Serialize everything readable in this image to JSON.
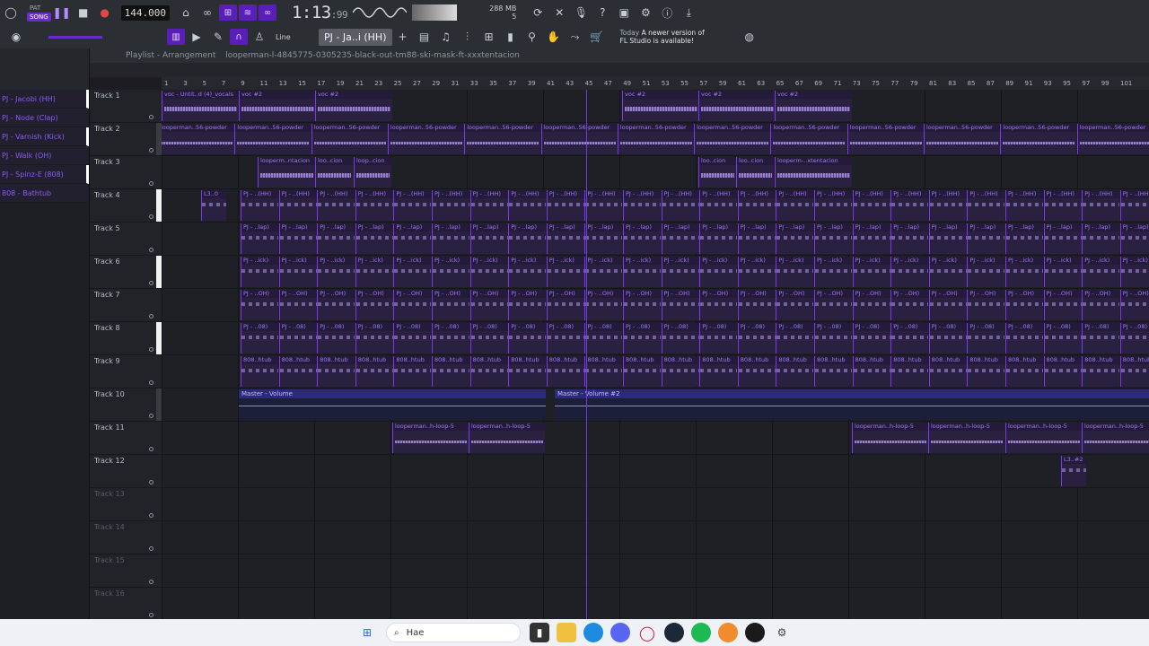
{
  "transport": {
    "mode_labels": [
      "PAT",
      "SONG"
    ],
    "tempo": "144.000",
    "time_main": "1:13",
    "time_sub": "99",
    "memory": "288 MB",
    "memory_sub": "5"
  },
  "toolbar2": {
    "snap": "Line",
    "pattern": "PJ - Ja..i (HH)",
    "news_line1_prefix": "Today",
    "news_line1": "A newer version of",
    "news_line2": "FL Studio is available!"
  },
  "playlist": {
    "title": "Playlist - Arrangement",
    "file": "looperman-l-4845775-0305235-black-out-tm88-ski-mask-ft-xxxtentacion"
  },
  "sidebar": {
    "items": [
      {
        "label": "PJ - Jacobi (HH)",
        "selected": true
      },
      {
        "label": "PJ - Node (Clap)",
        "selected": false
      },
      {
        "label": "PJ - Varnish (Kick)",
        "selected": true
      },
      {
        "label": "PJ - Walk (OH)",
        "selected": false
      },
      {
        "label": "PJ - Spinz-E (808)",
        "selected": true
      },
      {
        "label": "808 - Bathtub",
        "selected": false
      }
    ]
  },
  "ruler": [
    "1",
    "3",
    "5",
    "7",
    "9",
    "11",
    "13",
    "15",
    "17",
    "19",
    "21",
    "23",
    "25",
    "27",
    "29",
    "31",
    "33",
    "35",
    "37",
    "39",
    "41",
    "43",
    "45",
    "47",
    "49",
    "51",
    "53",
    "55",
    "57",
    "59",
    "61",
    "63",
    "65",
    "67",
    "69",
    "71",
    "73",
    "75",
    "77",
    "79",
    "81",
    "83",
    "85",
    "87",
    "89",
    "91",
    "93",
    "95",
    "97",
    "99",
    "101"
  ],
  "tracks": [
    {
      "name": "Track 1",
      "bar": "none",
      "active": true
    },
    {
      "name": "Track 2",
      "bar": "dark",
      "active": true
    },
    {
      "name": "Track 3",
      "bar": "none",
      "active": true
    },
    {
      "name": "Track 4",
      "bar": "white",
      "active": true
    },
    {
      "name": "Track 5",
      "bar": "none",
      "active": true
    },
    {
      "name": "Track 6",
      "bar": "white",
      "active": true
    },
    {
      "name": "Track 7",
      "bar": "none",
      "active": true
    },
    {
      "name": "Track 8",
      "bar": "white",
      "active": true
    },
    {
      "name": "Track 9",
      "bar": "none",
      "active": true
    },
    {
      "name": "Track 10",
      "bar": "dark",
      "active": true
    },
    {
      "name": "Track 11",
      "bar": "none",
      "active": true
    },
    {
      "name": "Track 12",
      "bar": "none",
      "active": true
    },
    {
      "name": "Track 13",
      "bar": "none",
      "active": false
    },
    {
      "name": "Track 14",
      "bar": "none",
      "active": false
    },
    {
      "name": "Track 15",
      "bar": "none",
      "active": false
    },
    {
      "name": "Track 16",
      "bar": "none",
      "active": false
    }
  ],
  "clip_labels": {
    "t1": [
      "voc - Untit..d (4)_vocals",
      "voc #2",
      "voc #2",
      "voc #2",
      "voc #2",
      "voc #2"
    ],
    "t2": "looperman..56-powder",
    "t3": [
      "looperm..ntacion",
      "loo..cion",
      "loop..cion",
      "loo..cion",
      "loo..cion",
      "looperm-..xtentacion"
    ],
    "t4": "PJ - ..(HH)",
    "t5": "PJ - ..lap)",
    "t6": "PJ - ..ick)",
    "t7": "PJ - ..OH)",
    "t8": "PJ - ..08)",
    "t9": "808..htub",
    "t10": [
      "Master - Volume",
      "Master - Volume #2"
    ],
    "t11": "looperman..h-loop-5",
    "t12": "L3..#2",
    "t4_first": "L3..0"
  },
  "taskbar": {
    "search_placeholder": "Hae",
    "icons": [
      "windows-start-icon",
      "file-explorer-icon",
      "edge-icon",
      "discord-icon",
      "opera-icon",
      "steam-icon",
      "spotify-icon",
      "fl-studio-icon",
      "chat-icon",
      "settings-icon"
    ]
  },
  "colors": {
    "accent": "#7c3aed",
    "clip": "#2a2140",
    "automation": "#2c2a7a"
  }
}
